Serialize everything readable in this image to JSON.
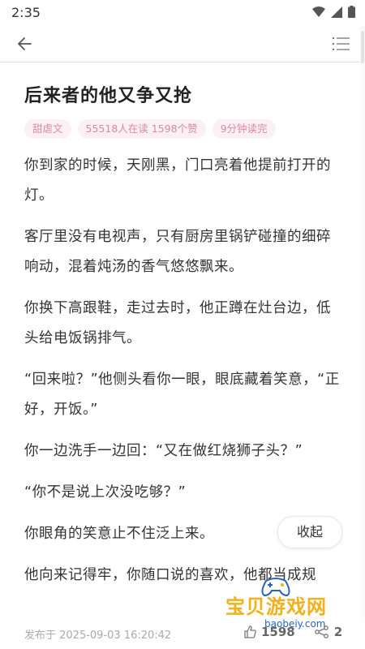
{
  "status_bar": {
    "time": "2:35"
  },
  "article": {
    "title": "后来者的他又争又抢",
    "tags": [
      "甜虐文",
      "55518人在读 1598个赞",
      "9分钟读完"
    ],
    "paragraphs": [
      "你到家的时候，天刚黑，门口亮着他提前打开的灯。",
      "客厅里没有电视声，只有厨房里锅铲碰撞的细碎响动，混着炖汤的香气悠悠飘来。",
      "你换下高跟鞋，走过去时，他正蹲在灶台边，低头给电饭锅排气。",
      "“回来啦？”他侧头看你一眼，眼底藏着笑意，“正好，开饭。”",
      "你一边洗手一边回：“又在做红烧狮子头？”",
      "“你不是说上次没吃够？”",
      "你眼角的笑意止不住泛上来。",
      "他向来记得牢，你随口说的喜欢，他都当成规"
    ]
  },
  "collapse_button": "收起",
  "footer": {
    "publish_time": "发布于 2025-09-03 16:20:42",
    "likes": "1598",
    "shares": "2"
  },
  "watermark": {
    "text": "宝贝游戏网",
    "url": "baobeiy.com"
  },
  "colors": {
    "accent": "#d98aa4",
    "tag_bg": "#fbf0f3",
    "divider": "#f1dbe2"
  }
}
